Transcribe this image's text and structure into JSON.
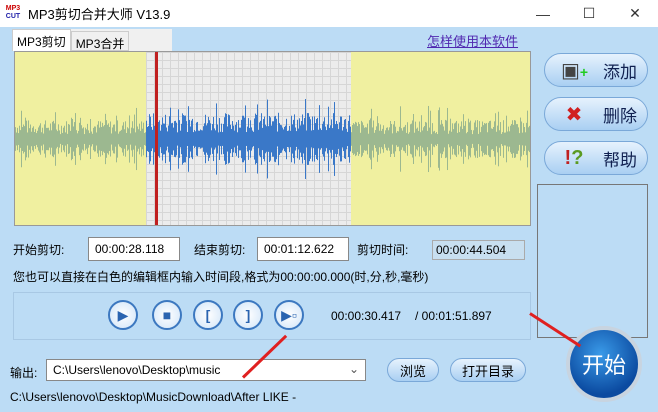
{
  "window": {
    "title": "MP3剪切合并大师 V13.9",
    "logo_text": "MP3 CUT",
    "minimize": "—",
    "maximize": "☐",
    "close": "✕"
  },
  "tabs": [
    {
      "label": "MP3剪切"
    },
    {
      "label": "MP3合并"
    }
  ],
  "help_link": "怎样使用本软件",
  "side_buttons": {
    "add": "添加",
    "delete": "删除",
    "help": "帮助"
  },
  "cut": {
    "start_label": "开始剪切:",
    "start_value": "00:00:28.118",
    "end_label": "结束剪切:",
    "end_value": "00:01:12.622",
    "duration_label": "剪切时间:",
    "duration_value": "00:00:44.504"
  },
  "hint": "您也可以直接在白色的编辑框内输入时间段,格式为00:00:00.000(时,分,秒,毫秒)",
  "playback": {
    "current": "00:00:30.417",
    "total": "/ 00:01:51.897"
  },
  "output": {
    "label": "输出:",
    "path": "C:\\Users\\lenovo\\Desktop\\music",
    "browse": "浏览",
    "open_dir": "打开目录"
  },
  "status_path": "C:\\Users\\lenovo\\Desktop\\MusicDownload\\After LIKE -",
  "start_button": "开始",
  "colors": {
    "background": "#bcdcf5",
    "wave_selected": "#3a78c8",
    "wave_unselected": "#9cb890",
    "marker": "#c02020"
  }
}
